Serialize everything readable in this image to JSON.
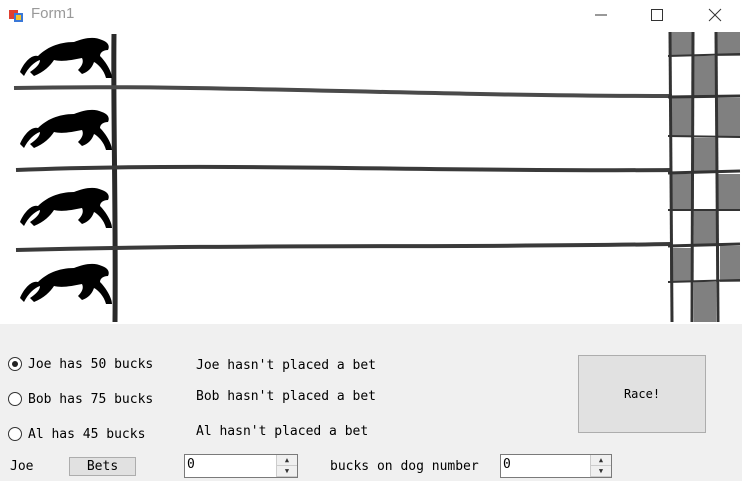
{
  "window": {
    "title": "Form1"
  },
  "bettors": [
    {
      "label": "Joe has 50 bucks",
      "status": "Joe hasn't placed a bet",
      "selected": true
    },
    {
      "label": "Bob has 75 bucks",
      "status": "Bob hasn't placed a bet",
      "selected": false
    },
    {
      "label": "Al has 45 bucks",
      "status": "Al hasn't placed a bet",
      "selected": false
    }
  ],
  "race_button": "Race!",
  "bet_row": {
    "name": "Joe",
    "bets_button": "Bets",
    "amount_value": "0",
    "middle_label": "bucks on dog number",
    "dog_value": "0"
  }
}
